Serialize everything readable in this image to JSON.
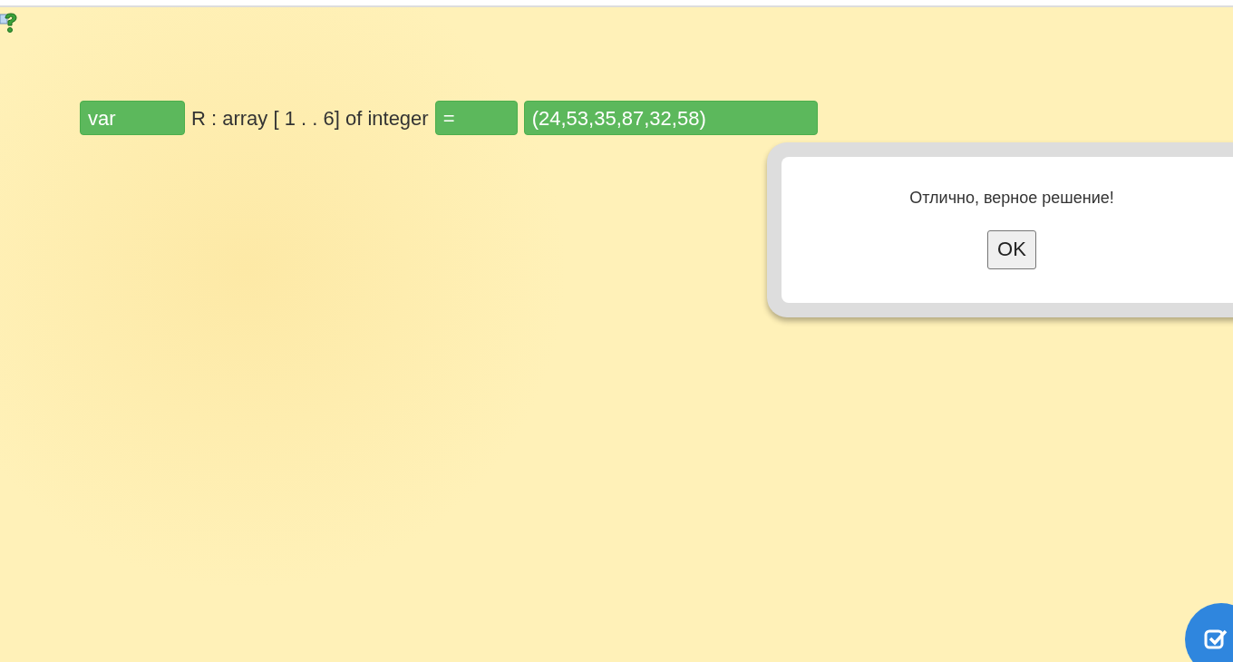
{
  "statement": [
    {
      "kind": "slot",
      "text": "var"
    },
    {
      "kind": "text",
      "text": "R : array [ 1 . . 6] of integer"
    },
    {
      "kind": "slot",
      "text": "="
    },
    {
      "kind": "slot",
      "text": "(24,53,35,87,32,58)"
    }
  ],
  "dialog": {
    "message": "Отлично, верное решение!",
    "button": "OK"
  }
}
